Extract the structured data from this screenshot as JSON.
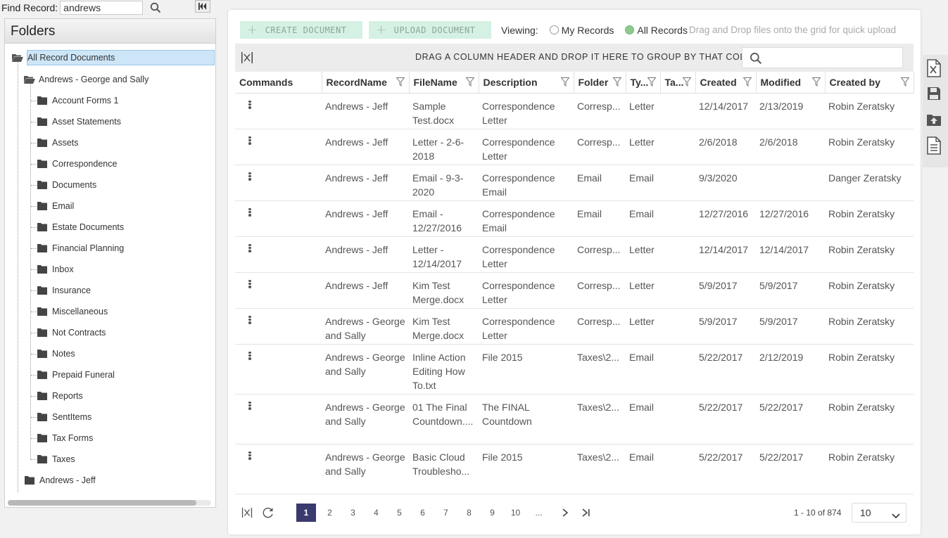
{
  "find": {
    "label": "Find Record:",
    "value": "andrews"
  },
  "folders": {
    "title": "Folders",
    "root": "All Record Documents",
    "group1": "Andrews - George and Sally",
    "children": [
      "Account Forms 1",
      "Asset Statements",
      "Assets",
      "Correspondence",
      "Documents",
      "Email",
      "Estate Documents",
      "Financial Planning",
      "Inbox",
      "Insurance",
      "Miscellaneous",
      "Not Contracts",
      "Notes",
      "Prepaid Funeral",
      "Reports",
      "SentItems",
      "Tax Forms",
      "Taxes"
    ],
    "group2": "Andrews - Jeff"
  },
  "toolbar": {
    "create": "CREATE DOCUMENT",
    "upload": "UPLOAD DOCUMENT",
    "viewing": "Viewing:",
    "my_records": "My Records",
    "all_records": "All Records",
    "hint": "Drag and Drop files onto the grid for quick upload"
  },
  "group_hint": "DRAG A COLUMN HEADER AND DROP IT HERE TO GROUP BY THAT COLUMN",
  "columns": [
    "Commands",
    "RecordName",
    "FileName",
    "Description",
    "Folder",
    "Ty...",
    "Ta...",
    "Created",
    "Modified",
    "Created by"
  ],
  "rows": [
    {
      "record": "Andrews - Jeff",
      "file": "Sample Test.docx",
      "desc": "Correspondence Letter",
      "folder": "Corresp...",
      "type": "Letter",
      "tags": "",
      "created": "12/14/2017",
      "modified": "2/13/2019",
      "by": "Robin Zeratsky"
    },
    {
      "record": "Andrews - Jeff",
      "file": "Letter - 2-6-2018",
      "desc": "Correspondence Letter",
      "folder": "Corresp...",
      "type": "Letter",
      "tags": "",
      "created": "2/6/2018",
      "modified": "2/6/2018",
      "by": "Robin Zeratsky"
    },
    {
      "record": "Andrews - Jeff",
      "file": "Email - 9-3-2020",
      "desc": "Correspondence Email",
      "folder": "Email",
      "type": "Email",
      "tags": "",
      "created": "9/3/2020",
      "modified": "",
      "by": "Danger Zeratsky"
    },
    {
      "record": "Andrews - Jeff",
      "file": "Email - 12/27/2016",
      "desc": "Correspondence Email",
      "folder": "Email",
      "type": "Email",
      "tags": "",
      "created": "12/27/2016",
      "modified": "12/27/2016",
      "by": "Robin Zeratsky"
    },
    {
      "record": "Andrews - Jeff",
      "file": "Letter - 12/14/2017",
      "desc": "Correspondence Letter",
      "folder": "Corresp...",
      "type": "Letter",
      "tags": "",
      "created": "12/14/2017",
      "modified": "12/14/2017",
      "by": "Robin Zeratsky"
    },
    {
      "record": "Andrews - Jeff",
      "file": "Kim Test Merge.docx",
      "desc": "Correspondence Letter",
      "folder": "Corresp...",
      "type": "Letter",
      "tags": "",
      "created": "5/9/2017",
      "modified": "5/9/2017",
      "by": "Robin Zeratsky"
    },
    {
      "record": "Andrews - George and Sally",
      "file": "Kim Test Merge.docx",
      "desc": "Correspondence Letter",
      "folder": "Corresp...",
      "type": "Letter",
      "tags": "",
      "created": "5/9/2017",
      "modified": "5/9/2017",
      "by": "Robin Zeratsky"
    },
    {
      "record": "Andrews - George and Sally",
      "file": "Inline Action Editing How To.txt",
      "desc": "File 2015",
      "folder": "Taxes\\2...",
      "type": "Email",
      "tags": "",
      "created": "5/22/2017",
      "modified": "2/12/2019",
      "by": "Robin Zeratsky"
    },
    {
      "record": "Andrews - George and Sally",
      "file": "01 The Final Countdown....",
      "desc": "The FINAL Countdown",
      "folder": "Taxes\\2...",
      "type": "Email",
      "tags": "",
      "created": "5/22/2017",
      "modified": "5/22/2017",
      "by": "Robin Zeratsky"
    },
    {
      "record": "Andrews - George and Sally",
      "file": "Basic Cloud Troublesho...",
      "desc": "File 2015",
      "folder": "Taxes\\2...",
      "type": "Email",
      "tags": "",
      "created": "5/22/2017",
      "modified": "5/22/2017",
      "by": "Robin Zeratsky"
    }
  ],
  "pager": {
    "pages": [
      "1",
      "2",
      "3",
      "4",
      "5",
      "6",
      "7",
      "8",
      "9",
      "10",
      "..."
    ],
    "info": "1 - 10 of 874",
    "page_size": "10"
  },
  "colors": {
    "accent": "#3a3a6e",
    "toolbar_btn": "#d4f1e3",
    "selected": "#cde6f7"
  },
  "icons": [
    "search-icon",
    "collapse-panel-icon",
    "folder-open-icon",
    "folder-icon",
    "group-toggle-icon",
    "filter-icon",
    "kebab-menu-icon",
    "refresh-icon",
    "next-page-icon",
    "last-page-icon",
    "excel-export-icon",
    "save-icon",
    "folder-upload-icon",
    "document-icon"
  ]
}
